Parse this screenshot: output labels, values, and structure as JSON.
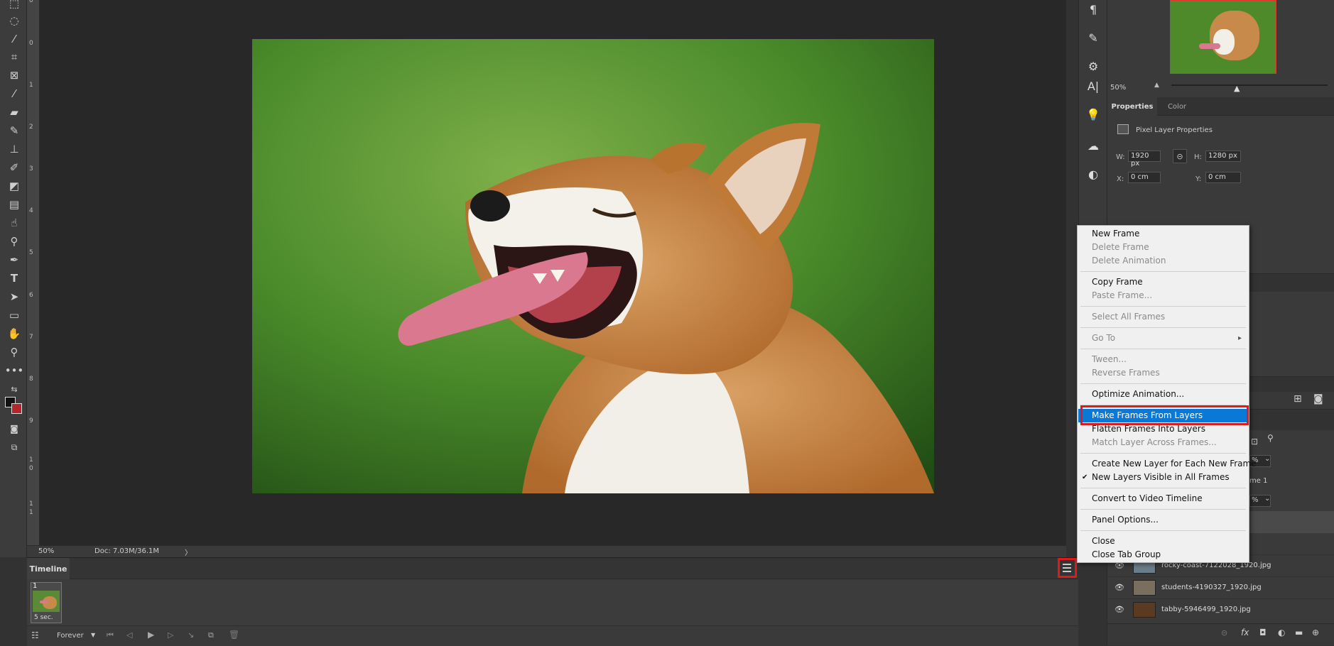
{
  "status": {
    "zoom": "50%",
    "doc": "Doc: 7.03M/36.1M",
    "arrow": "〉"
  },
  "timeline": {
    "tab": "Timeline",
    "frame_number": "1",
    "frame_delay": "5 sec.",
    "loop": "Forever"
  },
  "navigator": {
    "zoom": "50%"
  },
  "properties": {
    "tabs": [
      "Properties",
      "Color"
    ],
    "title": "Pixel Layer Properties",
    "w_label": "W:",
    "w_value": "1920 px",
    "h_label": "H:",
    "h_value": "1280 px",
    "x_label": "X:",
    "x_value": "0 cm",
    "y_label": "Y:",
    "y_value": "0 cm"
  },
  "layers": {
    "partial_1": "%",
    "partial_2": "me 1",
    "partial_3": "%",
    "items": [
      {
        "name": "rocky-coast-7122028_1920.jpg"
      },
      {
        "name": "students-4190327_1920.jpg"
      },
      {
        "name": "tabby-5946499_1920.jpg"
      }
    ]
  },
  "menu": {
    "items": [
      {
        "label": "New Frame",
        "enabled": true
      },
      {
        "label": "Delete Frame",
        "enabled": false
      },
      {
        "label": "Delete Animation",
        "enabled": false
      },
      {
        "label": "Copy Frame",
        "enabled": true
      },
      {
        "label": "Paste Frame...",
        "enabled": false
      },
      {
        "label": "Select All Frames",
        "enabled": false
      },
      {
        "label": "Go To",
        "enabled": false
      },
      {
        "label": "Tween...",
        "enabled": false
      },
      {
        "label": "Reverse Frames",
        "enabled": false
      },
      {
        "label": "Optimize Animation...",
        "enabled": true
      },
      {
        "label": "Make Frames From Layers",
        "enabled": true,
        "highlighted": true
      },
      {
        "label": "Flatten Frames Into Layers",
        "enabled": true
      },
      {
        "label": "Match Layer Across Frames...",
        "enabled": false
      },
      {
        "label": "Create New Layer for Each New Frame",
        "enabled": true
      },
      {
        "label": "New Layers Visible in All Frames",
        "enabled": true,
        "checked": true
      },
      {
        "label": "Convert to Video Timeline",
        "enabled": true
      },
      {
        "label": "Panel Options...",
        "enabled": true
      },
      {
        "label": "Close",
        "enabled": true
      },
      {
        "label": "Close Tab Group",
        "enabled": true
      }
    ],
    "check_mark": "✔",
    "submenu_arrow": "▸"
  },
  "colors": {
    "highlight": "#0a78d7",
    "annotation": "#e01a1a"
  },
  "ruler_labels": [
    "0",
    "1",
    "2",
    "3",
    "4",
    "5",
    "6",
    "7",
    "8",
    "9",
    "1",
    "0",
    "1",
    "1"
  ]
}
